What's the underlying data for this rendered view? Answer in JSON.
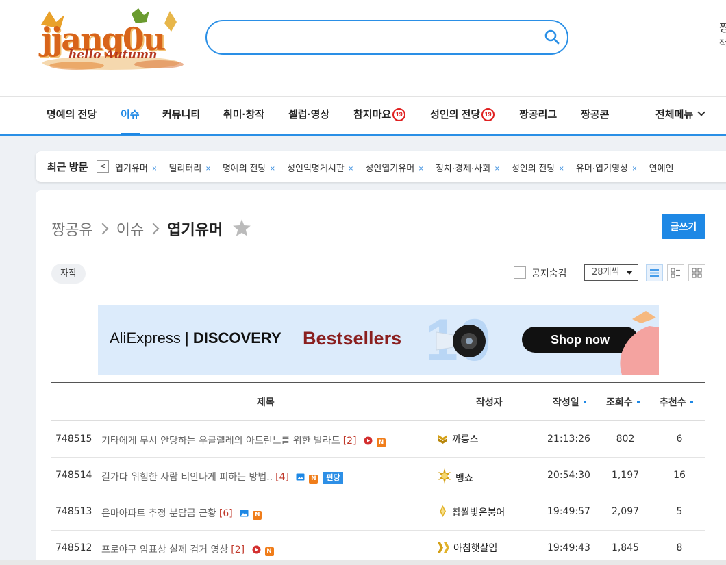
{
  "logo": {
    "name": "jjang0u",
    "tagline": "hello Autumn"
  },
  "search": {
    "placeholder": "",
    "value": ""
  },
  "top_right": {
    "line1": "짱",
    "line2": "작"
  },
  "nav": {
    "items": [
      {
        "label": "명예의 전당"
      },
      {
        "label": "이슈"
      },
      {
        "label": "커뮤니티"
      },
      {
        "label": "취미·창작"
      },
      {
        "label": "셀럽·영상"
      },
      {
        "label": "참지마요",
        "badge": "19"
      },
      {
        "label": "성인의 전당",
        "badge": "19"
      },
      {
        "label": "짱공리그"
      },
      {
        "label": "짱공콘"
      }
    ],
    "all_menu": "전체메뉴"
  },
  "recent": {
    "title": "최근 방문",
    "prev_glyph": "<",
    "close_glyph": "×",
    "items": [
      "엽기유머",
      "밀리터리",
      "명예의 전당",
      "성인익명게시판",
      "성인엽기유머",
      "정치·경제·사회",
      "성인의 전당",
      "유머·엽기영상",
      "연예인"
    ]
  },
  "breadcrumb": {
    "root": "짱공유",
    "section": "이슈",
    "current": "엽기유머"
  },
  "write_button": "글쓰기",
  "filters": {
    "tag": "자작",
    "hide_notice": "공지숨김",
    "per_page": "28개씩"
  },
  "ad": {
    "brand_a": "AliExpress",
    "brand_b": "DISCOVERY",
    "title": "Bestsellers",
    "number": "10",
    "cta": "Shop now"
  },
  "table": {
    "headers": {
      "title": "제목",
      "author": "작성자",
      "date": "작성일",
      "views": "조회수",
      "recommend": "추천수"
    },
    "rows": [
      {
        "num": "748515",
        "title": "기타에게 무시 안당하는 우쿨렐레의 아드린느를 위한 발라드",
        "comments": "[2]",
        "icons": [
          "video",
          "new"
        ],
        "hot": "",
        "author": "까릉스",
        "level": "gold-chevron",
        "time": "21:13:26",
        "views": "802",
        "rec": "6"
      },
      {
        "num": "748514",
        "title": "길가다 위험한 사람 티안나게 피하는 방법..",
        "comments": "[4]",
        "icons": [
          "image",
          "new"
        ],
        "hot": "펀당",
        "author": "뱅쇼",
        "level": "gold-sun",
        "time": "20:54:30",
        "views": "1,197",
        "rec": "16"
      },
      {
        "num": "748513",
        "title": "은마아파트 추정 분담금 근황",
        "comments": "[6]",
        "icons": [
          "image",
          "new"
        ],
        "hot": "",
        "author": "찹쌀빛은붕어",
        "level": "gold-drop",
        "time": "19:49:57",
        "views": "2,097",
        "rec": "5"
      },
      {
        "num": "748512",
        "title": "프로야구 암표상 실제 검거 영상",
        "comments": "[2]",
        "icons": [
          "video",
          "new"
        ],
        "hot": "",
        "author": "아침햇살임",
        "level": "gold-double",
        "time": "19:49:43",
        "views": "1,845",
        "rec": "8"
      }
    ]
  },
  "colors": {
    "accent": "#1e88e5",
    "comment": "#c0392b",
    "new_badge": "#f07d1a",
    "badge19": "#e02020"
  }
}
